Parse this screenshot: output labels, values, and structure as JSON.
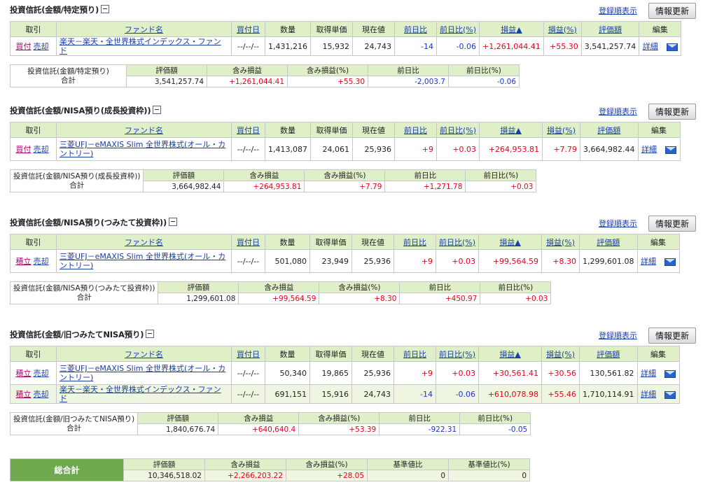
{
  "common": {
    "sort_label": "登録順表示",
    "refresh_label": "情報更新",
    "detail_label": "詳細",
    "headers": [
      "取引",
      "ファンド名",
      "買付日",
      "数量",
      "取得単価",
      "現在値",
      "前日比",
      "前日比(%)",
      "損益▲",
      "損益(%)",
      "評価額",
      "編集"
    ],
    "summary_headers": [
      "評価額",
      "含み損益",
      "含み損益(%)",
      "前日比",
      "前日比(%)"
    ],
    "summary_total_label": "合計"
  },
  "sections": [
    {
      "title": "投資信託(金額/特定預り)",
      "rows": [
        {
          "trade1": "買付",
          "trade2": "売却",
          "fund": "楽天－楽天・全世界株式インデックス・ファンド",
          "date": "--/--/--",
          "qty": "1,431,216",
          "cost": "15,932",
          "price": "24,743",
          "chg": "-14",
          "chg_pct": "-0.06",
          "pl": "+1,261,044.41",
          "pl_pct": "+55.30",
          "value": "3,541,257.74"
        }
      ],
      "summary": {
        "label": "投資信託(金額/特定預り)",
        "value": "3,541,257.74",
        "pl": "+1,261,044.41",
        "pl_pct": "+55.30",
        "chg": "-2,003.7",
        "chg_pct": "-0.06"
      }
    },
    {
      "title": "投資信託(金額/NISA預り(成長投資枠))",
      "rows": [
        {
          "trade1": "買付",
          "trade2": "売却",
          "fund": "三菱UFJ－eMAXIS Slim 全世界株式(オール・カントリー)",
          "date": "--/--/--",
          "qty": "1,413,087",
          "cost": "24,061",
          "price": "25,936",
          "chg": "+9",
          "chg_pct": "+0.03",
          "pl": "+264,953.81",
          "pl_pct": "+7.79",
          "value": "3,664,982.44"
        }
      ],
      "summary": {
        "label": "投資信託(金額/NISA預り(成長投資枠))",
        "value": "3,664,982.44",
        "pl": "+264,953.81",
        "pl_pct": "+7.79",
        "chg": "+1,271.78",
        "chg_pct": "+0.03"
      }
    },
    {
      "title": "投資信託(金額/NISA預り(つみたて投資枠))",
      "rows": [
        {
          "trade1": "積立",
          "trade2": "売却",
          "fund": "三菱UFJ－eMAXIS Slim 全世界株式(オール・カントリー)",
          "date": "--/--/--",
          "qty": "501,080",
          "cost": "23,949",
          "price": "25,936",
          "chg": "+9",
          "chg_pct": "+0.03",
          "pl": "+99,564.59",
          "pl_pct": "+8.30",
          "value": "1,299,601.08"
        }
      ],
      "summary": {
        "label": "投資信託(金額/NISA預り(つみたて投資枠))",
        "value": "1,299,601.08",
        "pl": "+99,564.59",
        "pl_pct": "+8.30",
        "chg": "+450.97",
        "chg_pct": "+0.03"
      }
    },
    {
      "title": "投資信託(金額/旧つみたてNISA預り)",
      "rows": [
        {
          "trade1": "積立",
          "trade2": "売却",
          "fund": "三菱UFJ－eMAXIS Slim 全世界株式(オール・カントリー)",
          "date": "--/--/--",
          "qty": "50,340",
          "cost": "19,865",
          "price": "25,936",
          "chg": "+9",
          "chg_pct": "+0.03",
          "pl": "+30,561.41",
          "pl_pct": "+30.56",
          "value": "130,561.82"
        },
        {
          "trade1": "積立",
          "trade2": "売却",
          "fund": "楽天－楽天・全世界株式インデックス・ファンド",
          "date": "--/--/--",
          "qty": "691,151",
          "cost": "15,916",
          "price": "24,743",
          "chg": "-14",
          "chg_pct": "-0.06",
          "pl": "+610,078.98",
          "pl_pct": "+55.46",
          "value": "1,710,114.91"
        }
      ],
      "summary": {
        "label": "投資信託(金額/旧つみたてNISA預り)",
        "value": "1,840,676.74",
        "pl": "+640,640.4",
        "pl_pct": "+53.39",
        "chg": "-922.31",
        "chg_pct": "-0.05"
      }
    }
  ],
  "grand_total": {
    "label": "総合計",
    "headers": [
      "評価額",
      "含み損益",
      "含み損益(%)",
      "基準値比",
      "基準値比(%)"
    ],
    "value": "10,346,518.02",
    "pl": "+2,266,203.22",
    "pl_pct": "+28.05",
    "base": "0",
    "base_pct": "0"
  },
  "colors": {
    "header_bg": "#dff0c8",
    "alt_row_bg": "#eef6e2",
    "grand_total_bg": "#6ea94e",
    "plus": "#e8001c",
    "minus": "#1f33d8",
    "link": "#1a3fa6"
  }
}
